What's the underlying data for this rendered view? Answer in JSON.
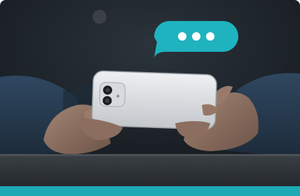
{
  "image": {
    "colors": {
      "background_dark": "#1c2228",
      "sleeve_blue": "#2a3f55",
      "skin": "#8a6e60",
      "phone_body": "#c9ccd0",
      "phone_back": "#e3e5e8",
      "camera": "#1b1e22",
      "desk": "#2f3337",
      "accent": "#1ea9b5",
      "bubble": "#1eb3bf",
      "bubble_dots": "#ffffff"
    }
  }
}
